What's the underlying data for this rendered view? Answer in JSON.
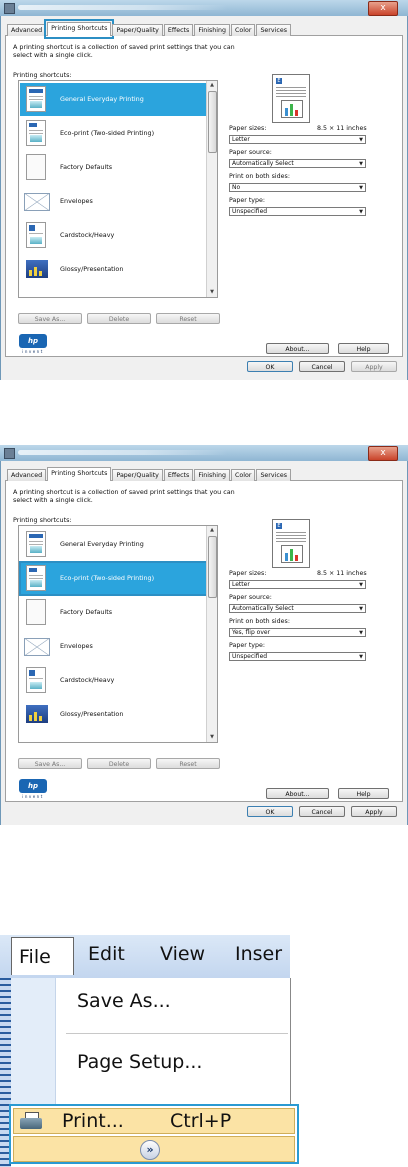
{
  "dialogs": [
    {
      "close_label": "x",
      "tabs": [
        "Advanced",
        "Printing Shortcuts",
        "Paper/Quality",
        "Effects",
        "Finishing",
        "Color",
        "Services"
      ],
      "description": "A printing shortcut is a collection of saved print settings that you can select with a single click.",
      "shortcuts_label": "Printing shortcuts:",
      "shortcuts": [
        "General Everyday Printing",
        "Eco-print (Two-sided Printing)",
        "Factory Defaults",
        "Envelopes",
        "Cardstock/Heavy",
        "Glossy/Presentation"
      ],
      "selected_index": 0,
      "buttons": {
        "save_as": "Save As...",
        "delete": "Delete",
        "reset": "Reset",
        "about": "About...",
        "help": "Help",
        "ok": "OK",
        "cancel": "Cancel",
        "apply": "Apply"
      },
      "paper_sizes_label": "Paper sizes:",
      "paper_sizes_dim": "8.5 × 11 inches",
      "paper_size_value": "Letter",
      "paper_source_label": "Paper source:",
      "paper_source_value": "Automatically Select",
      "both_sides_label": "Print on both sides:",
      "both_sides_value": "No",
      "paper_type_label": "Paper type:",
      "paper_type_value": "Unspecified",
      "hp_logo": "hp",
      "hp_tag": "invent"
    },
    {
      "close_label": "x",
      "tabs": [
        "Advanced",
        "Printing Shortcuts",
        "Paper/Quality",
        "Effects",
        "Finishing",
        "Color",
        "Services"
      ],
      "description": "A printing shortcut is a collection of saved print settings that you can select with a single click.",
      "shortcuts_label": "Printing shortcuts:",
      "shortcuts": [
        "General Everyday Printing",
        "Eco-print (Two-sided Printing)",
        "Factory Defaults",
        "Envelopes",
        "Cardstock/Heavy",
        "Glossy/Presentation"
      ],
      "selected_index": 1,
      "buttons": {
        "save_as": "Save As...",
        "delete": "Delete",
        "reset": "Reset",
        "about": "About...",
        "help": "Help",
        "ok": "OK",
        "cancel": "Cancel",
        "apply": "Apply"
      },
      "paper_sizes_label": "Paper sizes:",
      "paper_sizes_dim": "8.5 × 11 inches",
      "paper_size_value": "Letter",
      "paper_source_label": "Paper source:",
      "paper_source_value": "Automatically Select",
      "both_sides_label": "Print on both sides:",
      "both_sides_value": "Yes, flip over",
      "paper_type_label": "Paper type:",
      "paper_type_value": "Unspecified",
      "hp_logo": "hp",
      "hp_tag": "invent"
    }
  ],
  "menu": {
    "bar": [
      "File",
      "Edit",
      "View",
      "Inser"
    ],
    "items": {
      "save_as": "Save As...",
      "page_setup": "Page Setup...",
      "print": "Print...",
      "print_shortcut": "Ctrl+P"
    },
    "expand_glyph": "»"
  },
  "colors": {
    "selection": "#2ba4dd",
    "highlight": "#2a9ad2",
    "menu_hover": "#fbe3a5"
  }
}
